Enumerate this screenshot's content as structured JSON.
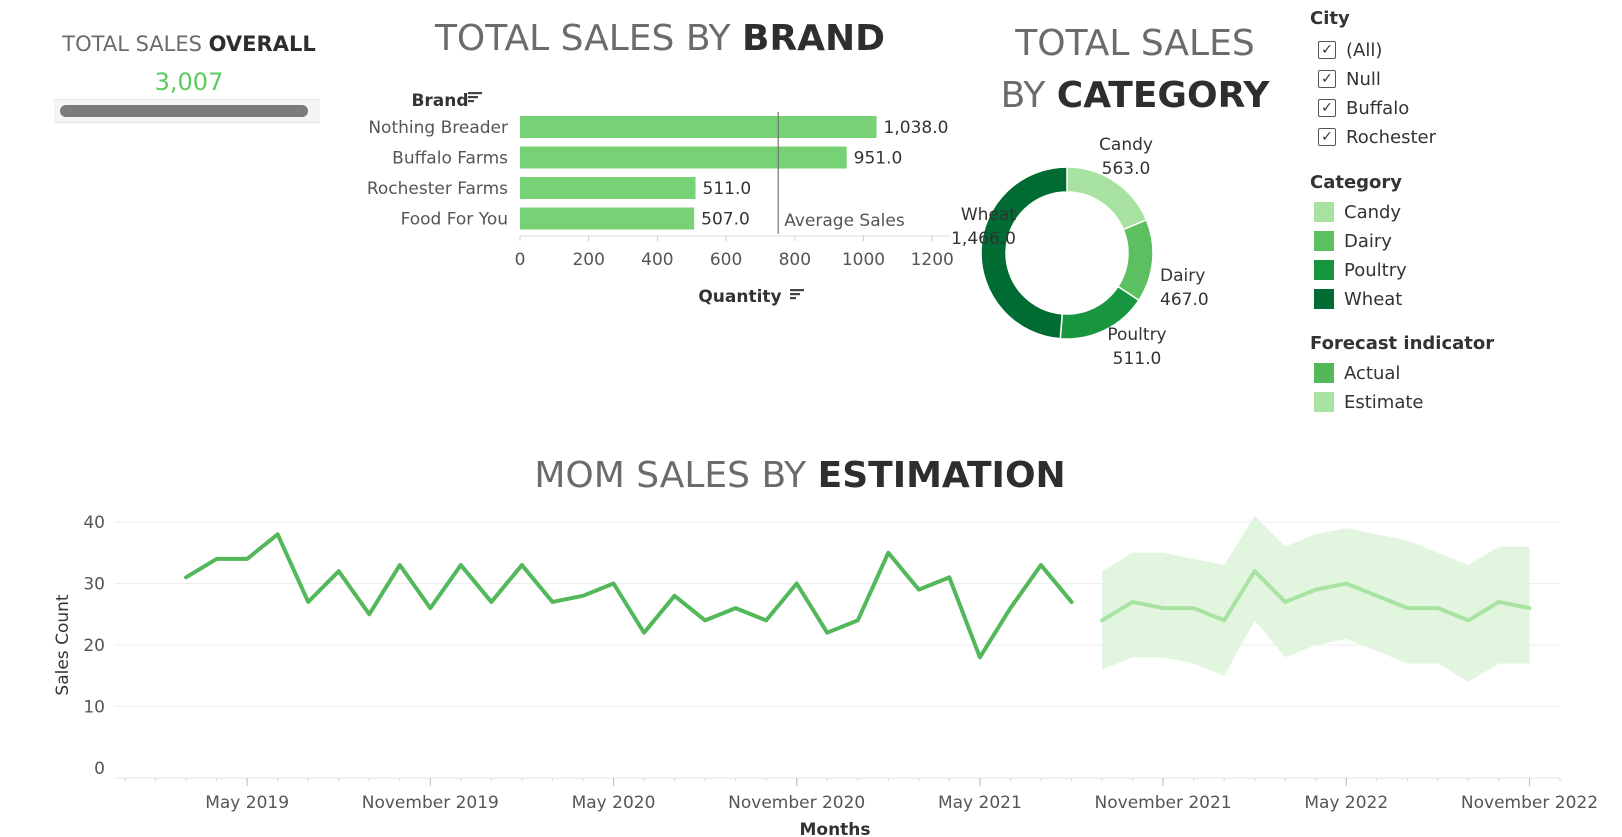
{
  "kpi": {
    "title_light": "TOTAL SALES ",
    "title_bold": "OVERALL",
    "value": "3,007",
    "value_color": "#5ccb5f"
  },
  "brand_title": {
    "light": "TOTAL SALES BY ",
    "bold": "BRAND"
  },
  "category_title": {
    "line1": "TOTAL SALES",
    "line2_light": "BY ",
    "line2_bold": "CATEGORY"
  },
  "mom_title": {
    "light": "MOM SALES BY ",
    "bold": "ESTIMATION"
  },
  "sort_icon": "sort-icon",
  "legends": {
    "city": {
      "title": "City",
      "items": [
        {
          "label": "(All)",
          "checked": true
        },
        {
          "label": "Null",
          "checked": true
        },
        {
          "label": "Buffalo",
          "checked": true
        },
        {
          "label": "Rochester",
          "checked": true
        }
      ]
    },
    "category": {
      "title": "Category",
      "items": [
        {
          "label": "Candy",
          "color": "#a7e2a0"
        },
        {
          "label": "Dairy",
          "color": "#5cbf60"
        },
        {
          "label": "Poultry",
          "color": "#18963f"
        },
        {
          "label": "Wheat",
          "color": "#006b33"
        }
      ]
    },
    "forecast": {
      "title": "Forecast indicator",
      "items": [
        {
          "label": "Actual",
          "color": "#52b85a"
        },
        {
          "label": "Estimate",
          "color": "#a9e3a4"
        }
      ]
    }
  },
  "chart_data": [
    {
      "type": "bar",
      "orientation": "horizontal",
      "title": "TOTAL SALES BY BRAND",
      "dimension_label": "Brand",
      "xlabel": "Quantity",
      "categories": [
        "Nothing Breader",
        "Buffalo Farms",
        "Rochester Farms",
        "Food For You"
      ],
      "values": [
        1038.0,
        951.0,
        511.0,
        507.0
      ],
      "data_labels": [
        "1,038.0",
        "951.0",
        "511.0",
        "507.0"
      ],
      "xlim": [
        0,
        1250
      ],
      "xticks": [
        0,
        200,
        400,
        600,
        800,
        1000,
        1200
      ],
      "reference_line": {
        "label": "Average Sales",
        "value": 751.75
      },
      "color": "#76d275"
    },
    {
      "type": "pie",
      "donut": true,
      "title": "TOTAL SALES BY CATEGORY",
      "slices": [
        {
          "label": "Candy",
          "value": 563.0,
          "display": "563.0",
          "color": "#a7e2a0"
        },
        {
          "label": "Dairy",
          "value": 467.0,
          "display": "467.0",
          "color": "#5cbf60"
        },
        {
          "label": "Poultry",
          "value": 511.0,
          "display": "511.0",
          "color": "#18963f"
        },
        {
          "label": "Wheat",
          "value": 1466.0,
          "display": "1,466.0",
          "color": "#006b33"
        }
      ]
    },
    {
      "type": "line",
      "title": "MOM SALES BY ESTIMATION",
      "xlabel": "Months",
      "ylabel": "Sales Count",
      "ylim": [
        0,
        40
      ],
      "yticks": [
        0,
        10,
        20,
        30,
        40
      ],
      "grid": true,
      "x_start": "2019-01",
      "x_end": "2022-12",
      "xtick_labels": [
        {
          "month": "2019-05",
          "label": "May 2019"
        },
        {
          "month": "2019-11",
          "label": "November 2019"
        },
        {
          "month": "2020-05",
          "label": "May 2020"
        },
        {
          "month": "2020-11",
          "label": "November 2020"
        },
        {
          "month": "2021-05",
          "label": "May 2021"
        },
        {
          "month": "2021-11",
          "label": "November 2021"
        },
        {
          "month": "2022-05",
          "label": "May 2022"
        },
        {
          "month": "2022-11",
          "label": "November 2022"
        }
      ],
      "series": [
        {
          "name": "Actual",
          "color": "#52b85a",
          "points": [
            [
              "2019-03",
              31
            ],
            [
              "2019-04",
              34
            ],
            [
              "2019-05",
              34
            ],
            [
              "2019-06",
              38
            ],
            [
              "2019-07",
              27
            ],
            [
              "2019-08",
              32
            ],
            [
              "2019-09",
              25
            ],
            [
              "2019-10",
              33
            ],
            [
              "2019-11",
              26
            ],
            [
              "2019-12",
              33
            ],
            [
              "2020-01",
              27
            ],
            [
              "2020-02",
              33
            ],
            [
              "2020-03",
              27
            ],
            [
              "2020-04",
              28
            ],
            [
              "2020-05",
              30
            ],
            [
              "2020-06",
              22
            ],
            [
              "2020-07",
              28
            ],
            [
              "2020-08",
              24
            ],
            [
              "2020-09",
              26
            ],
            [
              "2020-10",
              24
            ],
            [
              "2020-11",
              30
            ],
            [
              "2020-12",
              22
            ],
            [
              "2021-01",
              24
            ],
            [
              "2021-02",
              35
            ],
            [
              "2021-03",
              29
            ],
            [
              "2021-04",
              31
            ],
            [
              "2021-05",
              18
            ],
            [
              "2021-06",
              26
            ],
            [
              "2021-07",
              33
            ],
            [
              "2021-08",
              27
            ]
          ]
        },
        {
          "name": "Estimate",
          "color": "#a9e3a4",
          "band_color": "#e2f5df",
          "points": [
            [
              "2021-09",
              24
            ],
            [
              "2021-10",
              27
            ],
            [
              "2021-11",
              26
            ],
            [
              "2021-12",
              26
            ],
            [
              "2022-01",
              24
            ],
            [
              "2022-02",
              32
            ],
            [
              "2022-03",
              27
            ],
            [
              "2022-04",
              29
            ],
            [
              "2022-05",
              30
            ],
            [
              "2022-06",
              28
            ],
            [
              "2022-07",
              26
            ],
            [
              "2022-08",
              26
            ],
            [
              "2022-09",
              24
            ],
            [
              "2022-10",
              27
            ],
            [
              "2022-11",
              26
            ]
          ],
          "upper": [
            32,
            35,
            35,
            34,
            33,
            41,
            36,
            38,
            39,
            38,
            37,
            35,
            33,
            36,
            36
          ],
          "lower": [
            16,
            18,
            18,
            17,
            15,
            24,
            18,
            20,
            21,
            19,
            17,
            17,
            14,
            17,
            17
          ]
        }
      ]
    }
  ]
}
